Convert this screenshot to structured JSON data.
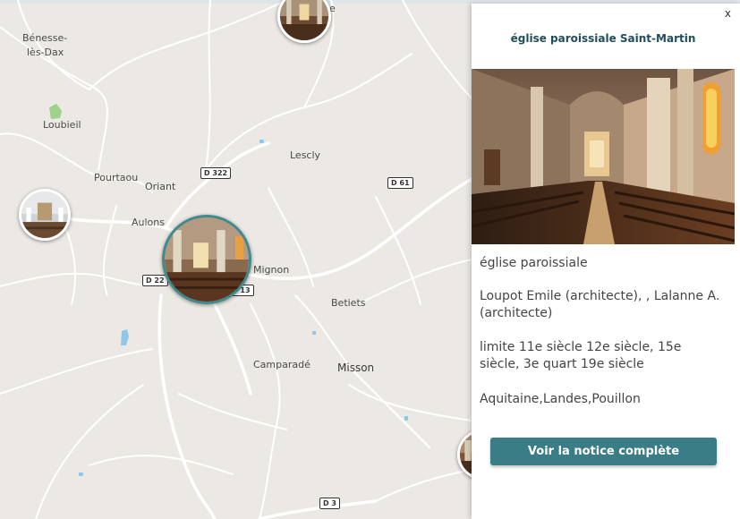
{
  "map": {
    "places": [
      {
        "name": "Bénesse-",
        "key": "benesse1"
      },
      {
        "name": "lès-Dax",
        "key": "benesse2"
      },
      {
        "name": "Loubieil",
        "key": "loubieil"
      },
      {
        "name": "Pourtaou",
        "key": "pourtaou"
      },
      {
        "name": "Oriant",
        "key": "oriant"
      },
      {
        "name": "Aulons",
        "key": "aulons"
      },
      {
        "name": "Lescly",
        "key": "lescly"
      },
      {
        "name": "Mignon",
        "key": "mignon"
      },
      {
        "name": "Betiets",
        "key": "betiets"
      },
      {
        "name": "Camparadé",
        "key": "camparade"
      },
      {
        "name": "Misson",
        "key": "misson"
      },
      {
        "name": "e",
        "key": "top_partial"
      }
    ],
    "roads": {
      "d322": "D 322",
      "d61": "D 61",
      "d22": "D 22",
      "d13": "D 13",
      "d3": "D 3"
    }
  },
  "panel": {
    "close_label": "x",
    "title": "église paroissiale Saint-Martin",
    "type": "église paroissiale",
    "architects": "Loupot Emile (architecte), , Lalanne A. (architecte)",
    "period": "limite 11e siècle 12e siècle, 15e siècle, 3e quart 19e siècle",
    "location": "Aquitaine,Landes,Pouillon",
    "button_label": "Voir la notice complète"
  },
  "colors": {
    "accent": "#3a7d86",
    "title": "#1f4e5a",
    "map_bg": "#ece9e4"
  }
}
